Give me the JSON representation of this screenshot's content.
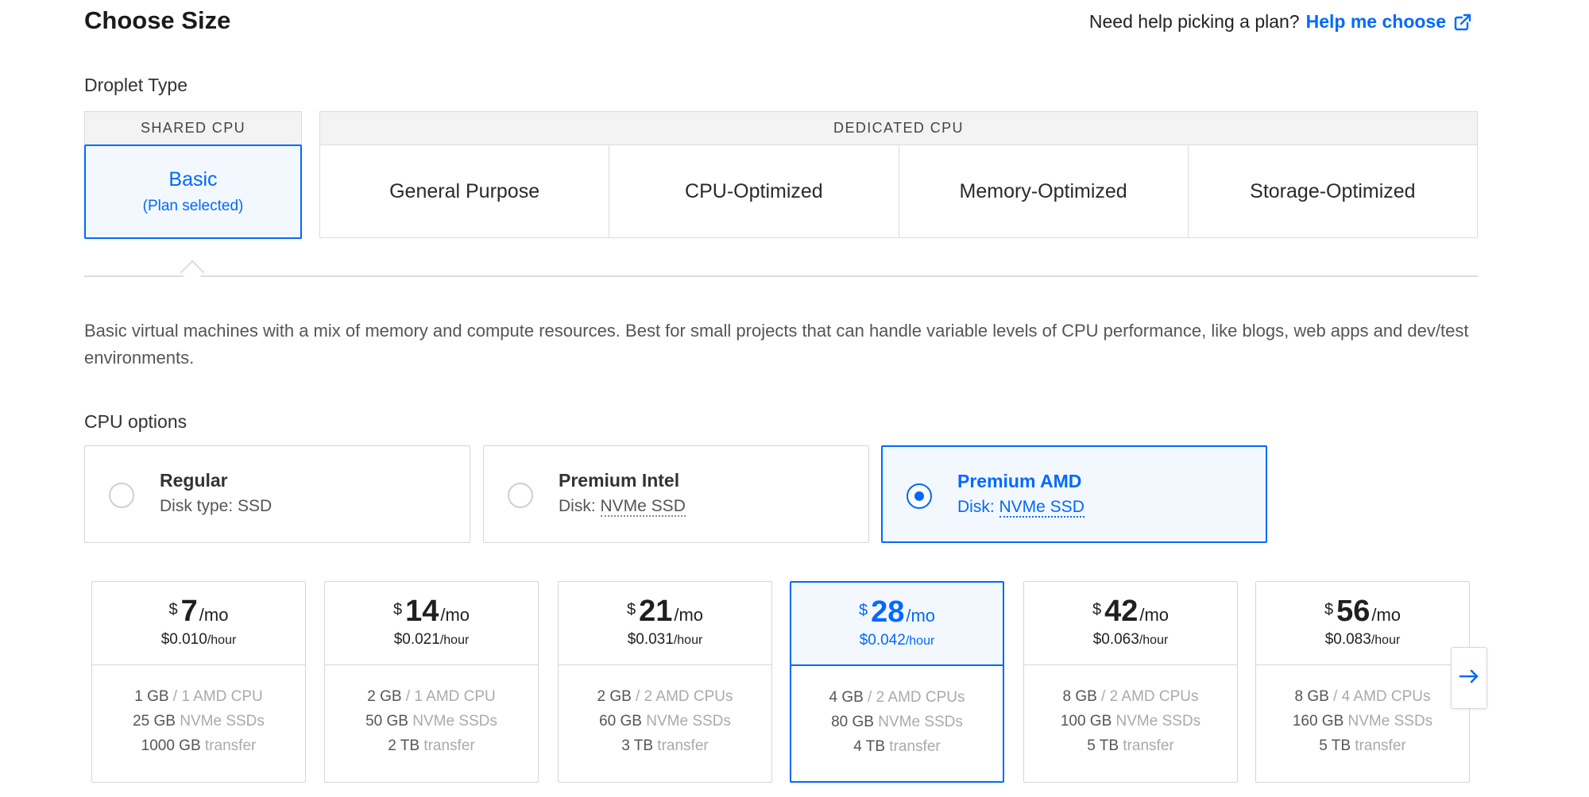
{
  "header": {
    "title": "Choose Size",
    "help_prompt": "Need help picking a plan?",
    "help_link": "Help me choose"
  },
  "droplet_type": {
    "label": "Droplet Type",
    "shared_header": "SHARED CPU",
    "basic": {
      "name": "Basic",
      "status": "(Plan selected)"
    },
    "dedicated_header": "DEDICATED CPU",
    "dedicated_tabs": [
      "General Purpose",
      "CPU-Optimized",
      "Memory-Optimized",
      "Storage-Optimized"
    ]
  },
  "description": "Basic virtual machines with a mix of memory and compute resources. Best for small projects that can handle variable levels of CPU performance, like blogs, web apps and dev/test environments.",
  "cpu_options": {
    "label": "CPU options",
    "options": [
      {
        "name": "Regular",
        "disk_label": "Disk type: ",
        "disk_value": "SSD",
        "selected": false
      },
      {
        "name": "Premium Intel",
        "disk_label": "Disk: ",
        "disk_value": "NVMe SSD",
        "selected": false
      },
      {
        "name": "Premium AMD",
        "disk_label": "Disk: ",
        "disk_value": "NVMe SSD",
        "selected": true
      }
    ]
  },
  "plans": [
    {
      "currency": "$",
      "amount": "7",
      "per": "/mo",
      "hourly": "$0.010",
      "hourly_unit": "/hour",
      "memory": "1 GB",
      "cpu": " / 1 AMD CPU",
      "disk": "25 GB",
      "disk_type": " NVMe SSDs",
      "transfer": "1000 GB",
      "transfer_label": " transfer",
      "selected": false
    },
    {
      "currency": "$",
      "amount": "14",
      "per": "/mo",
      "hourly": "$0.021",
      "hourly_unit": "/hour",
      "memory": "2 GB",
      "cpu": " / 1 AMD CPU",
      "disk": "50 GB",
      "disk_type": " NVMe SSDs",
      "transfer": "2 TB",
      "transfer_label": " transfer",
      "selected": false
    },
    {
      "currency": "$",
      "amount": "21",
      "per": "/mo",
      "hourly": "$0.031",
      "hourly_unit": "/hour",
      "memory": "2 GB",
      "cpu": " / 2 AMD CPUs",
      "disk": "60 GB",
      "disk_type": " NVMe SSDs",
      "transfer": "3 TB",
      "transfer_label": " transfer",
      "selected": false
    },
    {
      "currency": "$",
      "amount": "28",
      "per": "/mo",
      "hourly": "$0.042",
      "hourly_unit": "/hour",
      "memory": "4 GB",
      "cpu": " / 2 AMD CPUs",
      "disk": "80 GB",
      "disk_type": " NVMe SSDs",
      "transfer": "4 TB",
      "transfer_label": " transfer",
      "selected": true
    },
    {
      "currency": "$",
      "amount": "42",
      "per": "/mo",
      "hourly": "$0.063",
      "hourly_unit": "/hour",
      "memory": "8 GB",
      "cpu": " / 2 AMD CPUs",
      "disk": "100 GB",
      "disk_type": " NVMe SSDs",
      "transfer": "5 TB",
      "transfer_label": " transfer",
      "selected": false
    },
    {
      "currency": "$",
      "amount": "56",
      "per": "/mo",
      "hourly": "$0.083",
      "hourly_unit": "/hour",
      "memory": "8 GB",
      "cpu": " / 4 AMD CPUs",
      "disk": "160 GB",
      "disk_type": " NVMe SSDs",
      "transfer": "5 TB",
      "transfer_label": " transfer",
      "selected": false
    }
  ],
  "icons": {
    "external_link": "external-link-icon",
    "next": "arrow-right-icon"
  },
  "colors": {
    "accent": "#0069ff",
    "selected_bg": "#f3f8ff",
    "border": "#d6d6d6"
  }
}
